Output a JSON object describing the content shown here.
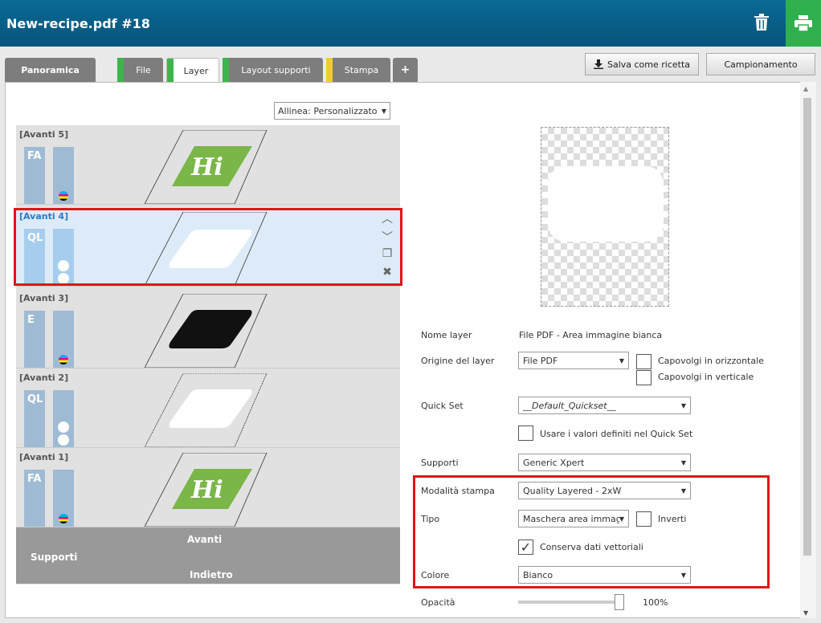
{
  "window": {
    "title": "New-recipe.pdf #18"
  },
  "tabs": [
    {
      "label": "Panoramica",
      "stripe": ""
    },
    {
      "label": "File",
      "stripe": "#3db54a"
    },
    {
      "label": "Layer",
      "stripe": "#3db54a"
    },
    {
      "label": "Layout supporti",
      "stripe": "#3db54a"
    },
    {
      "label": "Stampa",
      "stripe": "#f2cd2a"
    },
    {
      "label": "+"
    }
  ],
  "toolbar": {
    "save_recipe": "Salva come ricetta",
    "sampling": "Campionamento"
  },
  "align": {
    "value": "Allinea: Personalizzato"
  },
  "layers": [
    {
      "label": "[Avanti 5]",
      "type": "FA",
      "art": "hi-logo"
    },
    {
      "label": "[Avanti 4]",
      "type": "QL",
      "art": "white-rounded",
      "selected": true
    },
    {
      "label": "[Avanti 3]",
      "type": "E",
      "art": "black-rounded"
    },
    {
      "label": "[Avanti 2]",
      "type": "QL",
      "art": "white-rounded"
    },
    {
      "label": "[Avanti 1]",
      "type": "FA",
      "art": "hi-logo"
    }
  ],
  "supports_bar": {
    "label": "Supporti",
    "front": "Avanti",
    "back": "Indietro"
  },
  "form": {
    "layer_name_label": "Nome layer",
    "layer_name_value": "File PDF - Area immagine bianca",
    "origin_label": "Origine del layer",
    "origin_value": "File PDF",
    "flip_h": "Capovolgi in orizzontale",
    "flip_v": "Capovolgi in verticale",
    "quickset_label": "Quick Set",
    "quickset_value": "__Default_Quickset__",
    "use_quickset": "Usare i valori definiti nel Quick Set",
    "supports_label": "Supporti",
    "supports_value": "Generic Xpert",
    "print_mode_label": "Modalità stampa",
    "print_mode_value": "Quality Layered - 2xW",
    "type_label": "Tipo",
    "type_value": "Maschera area immagi",
    "invert": "Inverti",
    "keep_vector": "Conserva dati vettoriali",
    "keep_vector_checked": "✓",
    "color_label": "Colore",
    "color_value": "Bianco",
    "opacity_label": "Opacità",
    "opacity_value": "100%"
  },
  "colors": {
    "accent_red": "#e0151b",
    "header_blue": "#0a6a96",
    "print_green": "#2fb04d"
  }
}
